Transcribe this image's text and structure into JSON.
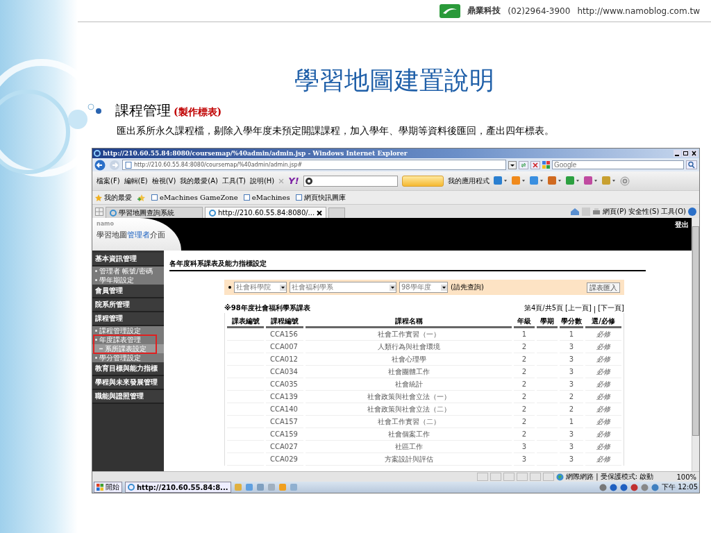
{
  "slide_header": {
    "company": "鼎業科技",
    "phone": "(02)2964-3900",
    "url": "http://www.namoblog.com.tw"
  },
  "title": "學習地圖建置說明",
  "bullet": {
    "heading": "課程管理",
    "note": "(製作標表)",
    "body": "匯出系所永久課程檔，剔除入學年度未預定開課課程，加入學年、學期等資料後匯回，產出四年標表。"
  },
  "browser": {
    "title": "http://210.60.55.84:8080/coursemap/%40admin/admin.jsp - Windows Internet Explorer",
    "address": "http://210.60.55.84:8080/coursemap/%40admin/admin.jsp#",
    "search_placeholder": "Google",
    "menus": [
      "檔案(F)",
      "編輯(E)",
      "檢視(V)",
      "我的最愛(A)",
      "工具(T)",
      "說明(H)"
    ],
    "toolbar_logo": "Y!",
    "apps_label": "我的應用程式",
    "favorites": {
      "label": "我的最愛",
      "links": [
        "eMachines GameZone",
        "eMachines",
        "網頁快訊圖庫"
      ]
    },
    "tabs": [
      {
        "label": "學習地圖查詢系統",
        "selected": false
      },
      {
        "label": "http://210.60.55.84:8080/...",
        "selected": true
      }
    ],
    "commands": [
      "網頁(P)",
      "安全性(S)",
      "工具(O)"
    ],
    "status": "網際網路 | 受保護模式: 啟動",
    "zoom": "100%"
  },
  "app": {
    "brand": "namo",
    "title": {
      "before": "學習地圖",
      "highlight": "管理者",
      "after": "介面"
    },
    "logout": "登出",
    "sidebar": [
      {
        "kind": "section",
        "label": "基本資訊管理"
      },
      {
        "kind": "link",
        "label": "管理者 帳號/密碼",
        "selected": false
      },
      {
        "kind": "link",
        "label": "學年期設定",
        "selected": false
      },
      {
        "kind": "section",
        "label": "會員管理"
      },
      {
        "kind": "section",
        "label": "院系所管理"
      },
      {
        "kind": "section",
        "label": "課程管理"
      },
      {
        "kind": "link",
        "label": "課程管理設定",
        "selected": false
      },
      {
        "kind": "callout",
        "items": [
          {
            "kind": "link",
            "label": "年度課表管理",
            "selected": false
          },
          {
            "kind": "sublink",
            "label": "系所課表設定",
            "selected": true
          }
        ]
      },
      {
        "kind": "link",
        "label": "學分管理設定",
        "selected": false
      },
      {
        "kind": "section",
        "label": "教育目標與能力指標"
      },
      {
        "kind": "section",
        "label": "學程與未來發展管理"
      },
      {
        "kind": "section",
        "label": "職能與證照管理"
      }
    ],
    "heading": "各年度科系課表及能力指標設定",
    "filter": {
      "college": "社會科學院",
      "department": "社會福利學系",
      "year": "98學年度",
      "hint": "(請先查詢)",
      "import_button": "課表匯入"
    },
    "table": {
      "caption": "※98年度社會福利學系課表",
      "pager": {
        "info": "第4頁/共5頁",
        "prev": "[上一頁]",
        "separator": "|",
        "next": "[下一頁]"
      },
      "columns": [
        "課表編號",
        "課程編號",
        "課程名稱",
        "年級",
        "學期",
        "學分數",
        "選/必修"
      ],
      "rows": [
        {
          "code": "CCA156",
          "name": "社會工作實習（一）",
          "grade": "1",
          "credits": "1",
          "type": "必修"
        },
        {
          "code": "CCA007",
          "name": "人類行為與社會環境",
          "grade": "2",
          "credits": "3",
          "type": "必修"
        },
        {
          "code": "CCA012",
          "name": "社會心理學",
          "grade": "2",
          "credits": "3",
          "type": "必修"
        },
        {
          "code": "CCA034",
          "name": "社會團體工作",
          "grade": "2",
          "credits": "3",
          "type": "必修"
        },
        {
          "code": "CCA035",
          "name": "社會統計",
          "grade": "2",
          "credits": "3",
          "type": "必修"
        },
        {
          "code": "CCA139",
          "name": "社會政策與社會立法（一）",
          "grade": "2",
          "credits": "2",
          "type": "必修"
        },
        {
          "code": "CCA140",
          "name": "社會政策與社會立法（二）",
          "grade": "2",
          "credits": "2",
          "type": "必修"
        },
        {
          "code": "CCA157",
          "name": "社會工作實習（二）",
          "grade": "2",
          "credits": "1",
          "type": "必修"
        },
        {
          "code": "CCA159",
          "name": "社會個案工作",
          "grade": "2",
          "credits": "3",
          "type": "必修"
        },
        {
          "code": "CCA027",
          "name": "社區工作",
          "grade": "3",
          "credits": "3",
          "type": "必修"
        },
        {
          "code": "CCA029",
          "name": "方案設計與評估",
          "grade": "3",
          "credits": "3",
          "type": "必修"
        }
      ]
    }
  },
  "taskbar": {
    "start": "開始",
    "task": "http://210.60.55.84:8...",
    "clock": "下午 12:05"
  }
}
